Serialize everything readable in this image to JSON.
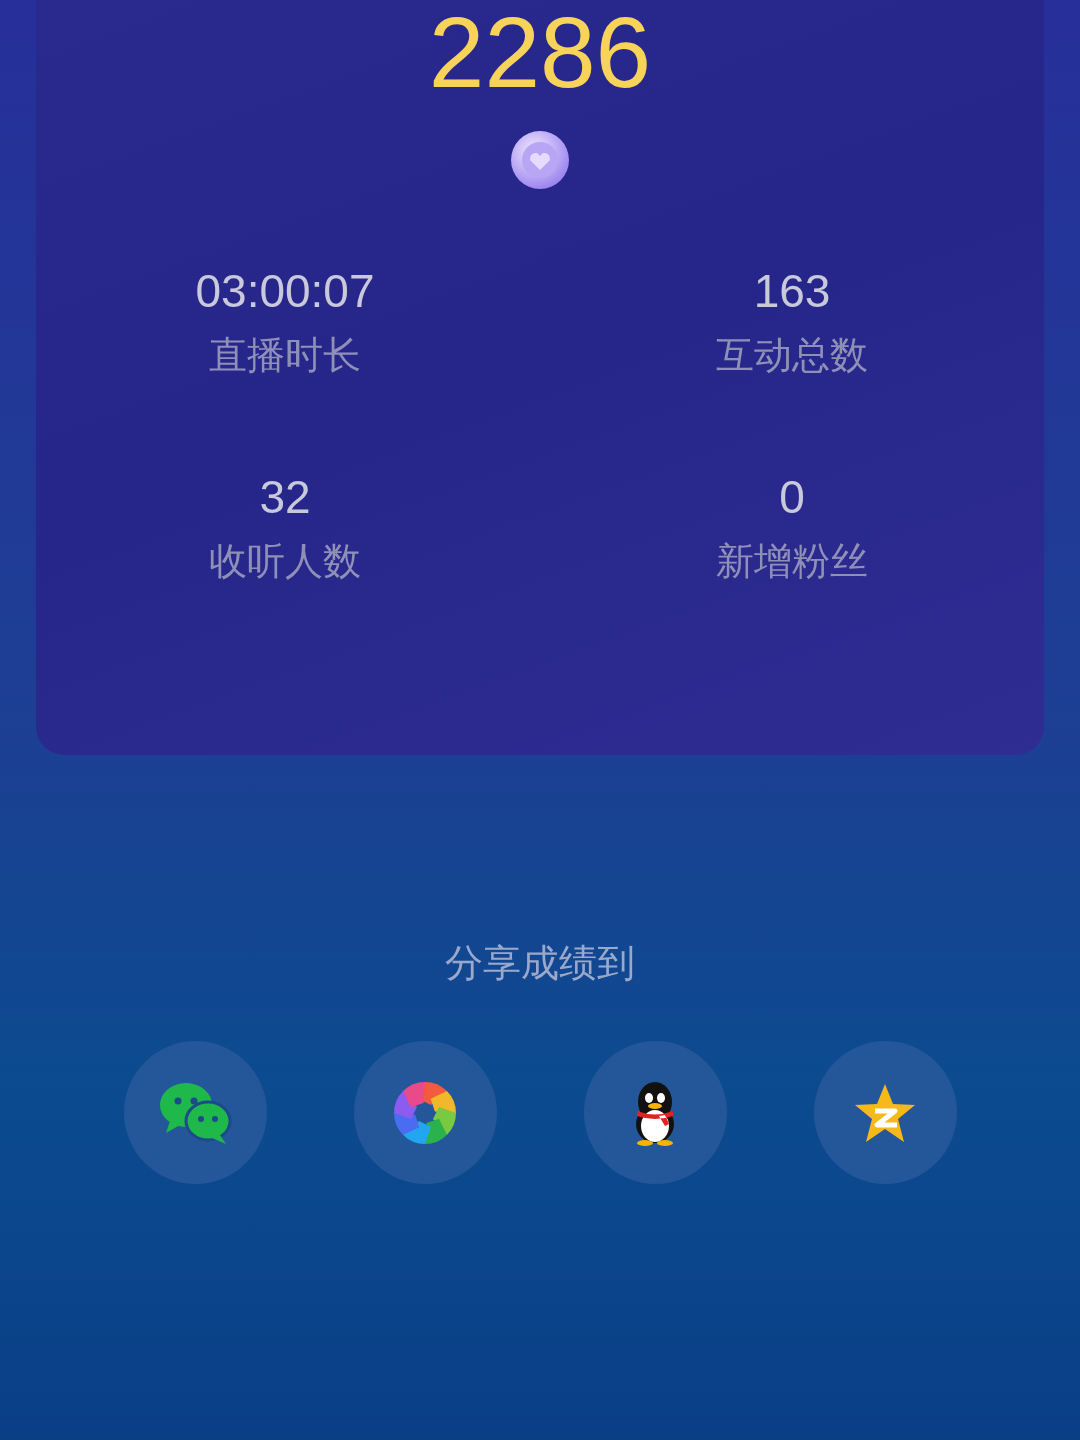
{
  "total": "2286",
  "stats": [
    {
      "value": "03:00:07",
      "label": "直播时长"
    },
    {
      "value": "163",
      "label": "互动总数"
    },
    {
      "value": "32",
      "label": "收听人数"
    },
    {
      "value": "0",
      "label": "新增粉丝"
    }
  ],
  "share": {
    "title": "分享成绩到",
    "targets": [
      {
        "kind": "chat"
      },
      {
        "kind": "aperture"
      },
      {
        "kind": "penguin"
      },
      {
        "kind": "star"
      }
    ]
  }
}
